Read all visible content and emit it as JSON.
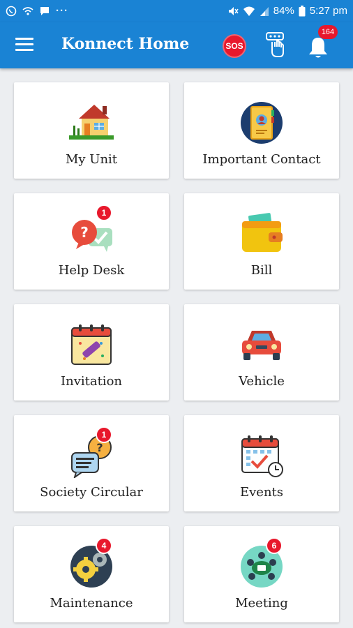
{
  "status_bar": {
    "battery": "84%",
    "time": "5:27 pm"
  },
  "app_bar": {
    "title": "Konnect Home",
    "sos_label": "SOS",
    "notification_count": "164"
  },
  "tiles": [
    {
      "label": "My Unit",
      "icon": "house-icon",
      "badge": ""
    },
    {
      "label": "Important Contact",
      "icon": "contact-book-icon",
      "badge": ""
    },
    {
      "label": "Help Desk",
      "icon": "help-chat-icon",
      "badge": "1"
    },
    {
      "label": "Bill",
      "icon": "wallet-icon",
      "badge": ""
    },
    {
      "label": "Invitation",
      "icon": "party-calendar-icon",
      "badge": ""
    },
    {
      "label": "Vehicle",
      "icon": "car-icon",
      "badge": ""
    },
    {
      "label": "Society Circular",
      "icon": "circular-chat-icon",
      "badge": "1"
    },
    {
      "label": "Events",
      "icon": "event-calendar-icon",
      "badge": ""
    },
    {
      "label": "Maintenance",
      "icon": "gears-icon",
      "badge": "4"
    },
    {
      "label": "Meeting",
      "icon": "meeting-table-icon",
      "badge": "6"
    }
  ],
  "colors": {
    "primary": "#1a83d4",
    "badge": "#e8182c",
    "background": "#eceef1"
  }
}
